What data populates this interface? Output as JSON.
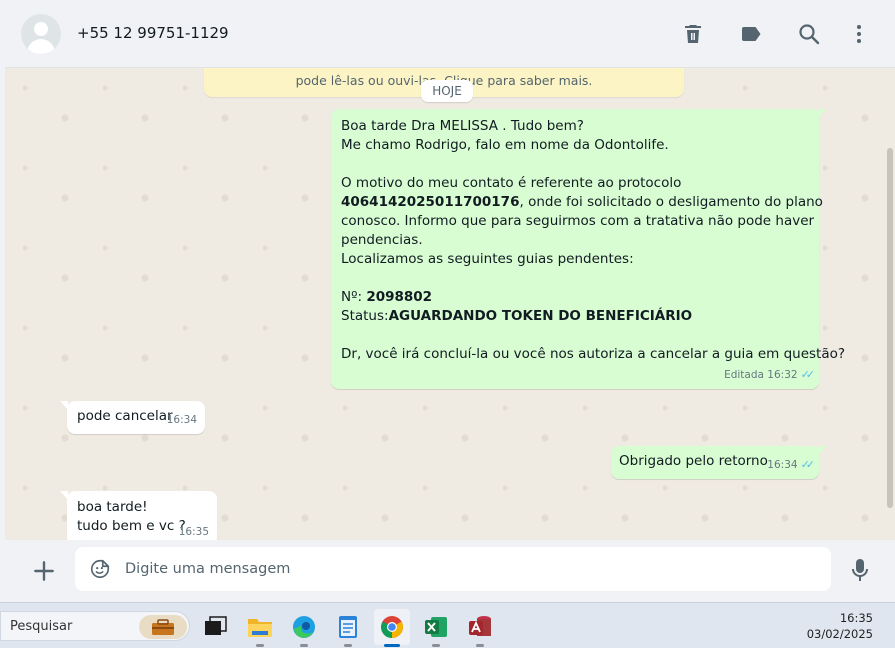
{
  "header": {
    "contact": "+55 12 99751-1129",
    "icons": [
      "trash-icon",
      "label-icon",
      "search-icon",
      "more-vertical-icon"
    ]
  },
  "chat": {
    "notice_text": "pode lê-las ou ouvi-las. Clique para saber mais.",
    "day_chip": "HOJE",
    "messages": [
      {
        "direction": "out",
        "lines": [
          "Boa tarde Dra MELISSA . Tudo bem?",
          "Me chamo Rodrigo, falo em nome da Odontolife.",
          "",
          "O motivo do meu contato é referente ao protocolo",
          "4064142025011700176",
          ", onde foi solicitado o desligamento do plano",
          "conosco. Informo que para seguirmos com a tratativa não pode haver",
          "pendencias.",
          "Localizamos as seguintes guias pendentes:",
          "",
          "Nº: ",
          "2098802",
          "Status:",
          "AGUARDANDO TOKEN DO BENEFICIÁRIO",
          "",
          "Dr, você irá concluí-la ou você nos autoriza a cancelar a guia em questão?"
        ],
        "edited_label": "Editada",
        "time": "16:32",
        "ticks": "✓✓"
      },
      {
        "direction": "in",
        "text": "pode cancelar",
        "time": "16:34"
      },
      {
        "direction": "out",
        "text": "Obrigado pelo retorno",
        "time": "16:34",
        "ticks": "✓✓"
      },
      {
        "direction": "in",
        "lines": [
          "boa tarde!",
          "tudo bem e vc ?"
        ],
        "time": "16:35"
      }
    ]
  },
  "composer": {
    "placeholder": "Digite uma mensagem"
  },
  "taskbar": {
    "search_label": "Pesquisar",
    "apps": [
      "task-view",
      "file-explorer",
      "edge",
      "notepad",
      "chrome",
      "excel",
      "access"
    ],
    "time": "16:35",
    "date": "03/02/2025"
  },
  "colors": {
    "outgoing_bubble": "#d9fdd3",
    "incoming_bubble": "#ffffff",
    "chat_background": "#efeae2",
    "read_ticks": "#53bdeb"
  }
}
